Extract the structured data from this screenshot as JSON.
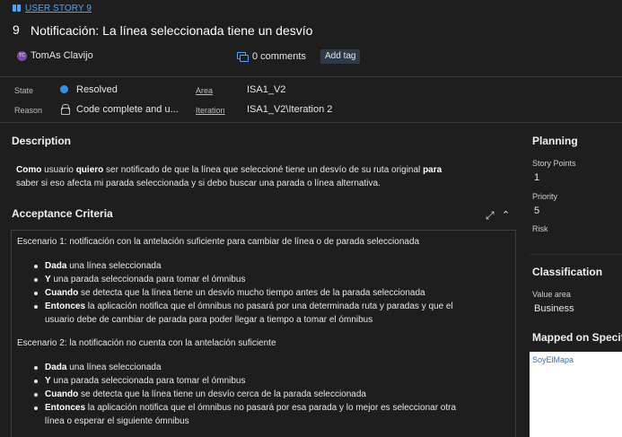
{
  "header": {
    "type_label": "USER STORY 9",
    "id": "9",
    "title": "Notificación: La línea seleccionada tiene un desvío",
    "assignee_initials": "TC",
    "assignee": "TomAs Clavijo",
    "comments": "0 comments",
    "add_tag": "Add tag"
  },
  "fields": {
    "state_label": "State",
    "state_value": "Resolved",
    "reason_label": "Reason",
    "reason_value": "Code complete and u...",
    "area_label": "Area",
    "area_value": "ISA1_V2",
    "iteration_label": "Iteration",
    "iteration_value": "ISA1_V2\\Iteration 2"
  },
  "description": {
    "heading": "Description",
    "p1_b1": "Como",
    "p1_t1": " usuario ",
    "p1_b2": "quiero",
    "p1_t2": " ser notificado de que la línea que seleccioné tiene un desvío de su ruta original ",
    "p1_b3": "para",
    "p1_t3": "saber si eso afecta mi parada seleccionada y si debo buscar una parada o línea alternativa."
  },
  "acceptance": {
    "heading": "Acceptance Criteria",
    "scenario1": "Escenario 1: notificación con la antelación suficiente para cambiar de línea o de parada seleccionada",
    "s1": [
      {
        "kw": "Dada",
        "text": " una línea seleccionada"
      },
      {
        "kw": "Y",
        "text": " una parada seleccionada para tomar el ómnibus"
      },
      {
        "kw": "Cuando",
        "text": " se detecta que la línea tiene un desvío mucho tiempo antes de la parada seleccionada"
      },
      {
        "kw": "Entonces",
        "text": " la aplicación notifica que el ómnibus no pasará por una determinada ruta y paradas y que el"
      },
      {
        "kw": "",
        "text": "usuario debe de cambiar de parada para poder llegar a tiempo a tomar el ómnibus"
      }
    ],
    "scenario2": "Escenario 2: la notificación no cuenta con la antelación suficiente",
    "s2": [
      {
        "kw": "Dada",
        "text": " una línea seleccionada"
      },
      {
        "kw": "Y",
        "text": " una parada seleccionada para tomar el ómnibus"
      },
      {
        "kw": "Cuando",
        "text": " se detecta que la línea tiene un desvío cerca de la parada seleccionada"
      },
      {
        "kw": "Entonces",
        "text": " la aplicación notifica que el ómnibus no pasará por esa parada y lo mejor es seleccionar otra"
      },
      {
        "kw": "",
        "text": "línea o esperar el siguiente ómnibus"
      }
    ]
  },
  "planning": {
    "heading": "Planning",
    "story_points_label": "Story Points",
    "story_points": "1",
    "priority_label": "Priority",
    "priority": "5",
    "risk_label": "Risk"
  },
  "classification": {
    "heading": "Classification",
    "value_area_label": "Value area",
    "value_area": "Business"
  },
  "mapped": {
    "heading": "Mapped on Specif",
    "link": "SoyElMapa"
  },
  "colors": {
    "background": "#1e1e1e",
    "accent": "#4da3ff",
    "resolved": "#3a8ee6",
    "avatar": "#7b4aa7"
  }
}
